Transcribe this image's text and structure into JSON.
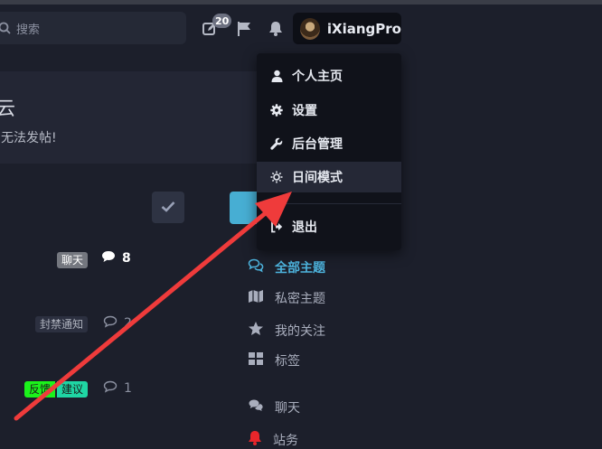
{
  "header": {
    "search_placeholder": "搜索",
    "drafts_count": "20",
    "username": "iXiangPro"
  },
  "hero": {
    "title": "云",
    "notice": "无法发帖!"
  },
  "discussions": [
    {
      "tags": [
        "聊天"
      ],
      "reply_count": "8",
      "unread": true
    },
    {
      "tags": [
        "封禁通知"
      ],
      "reply_count": "2",
      "unread": false
    },
    {
      "tags": [
        "反馈",
        "建议"
      ],
      "reply_count": "1",
      "unread": false
    }
  ],
  "sidebar": {
    "items": [
      {
        "label": "全部主题",
        "icon": "comments-icon",
        "active": true
      },
      {
        "label": "私密主题",
        "icon": "map-icon"
      },
      {
        "label": "我的关注",
        "icon": "star-icon"
      },
      {
        "label": "标签",
        "icon": "grid-icon"
      },
      {
        "label": "聊天",
        "icon": "chat-bubbles-icon"
      },
      {
        "label": "站务",
        "icon": "bell-icon",
        "color": "#e8262b"
      }
    ]
  },
  "user_menu": {
    "items": [
      {
        "label": "个人主页",
        "icon": "user-icon"
      },
      {
        "label": "设置",
        "icon": "gear-icon"
      },
      {
        "label": "后台管理",
        "icon": "wrench-icon"
      },
      {
        "label": "日间模式",
        "icon": "sun-icon",
        "hovered": true
      },
      {
        "label": "退出",
        "icon": "sign-out-icon"
      }
    ]
  },
  "colors": {
    "background": "#1c1f2b",
    "accent": "#47aed3",
    "arrow": "#ef3b3b",
    "tag_feedback": "#1bf21b",
    "tag_suggest": "#1fd6a4"
  }
}
